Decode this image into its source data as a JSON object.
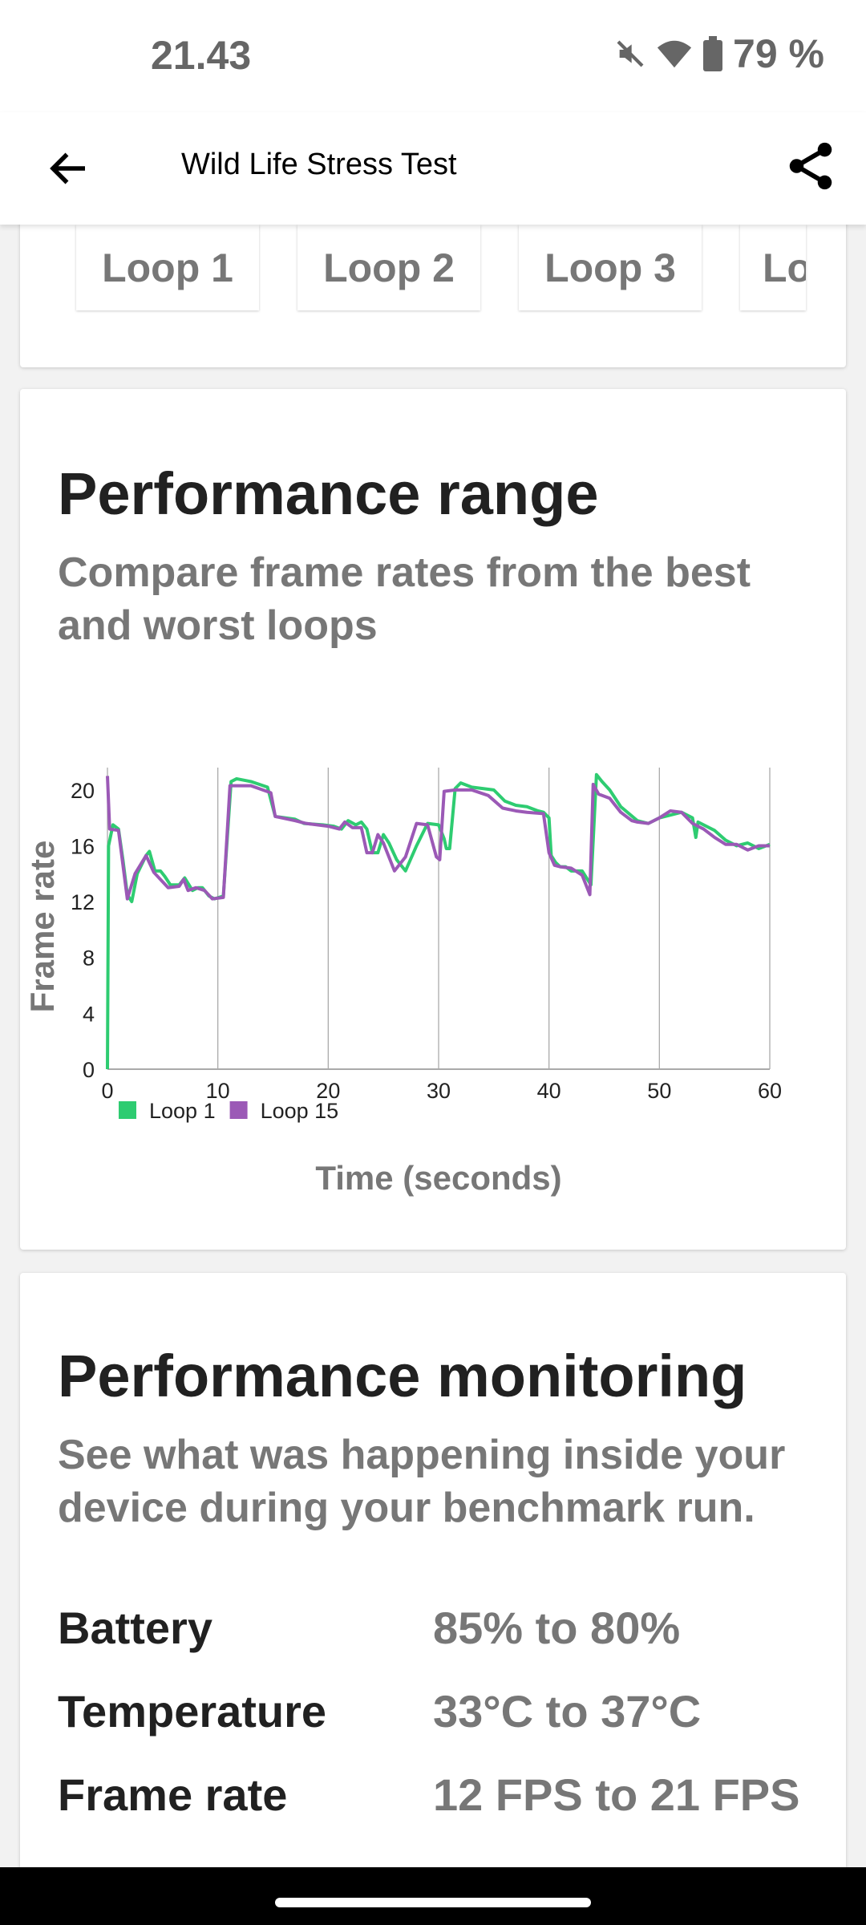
{
  "status_bar": {
    "time": "21.43",
    "battery": "79 %",
    "icons": [
      "mute-icon",
      "wifi-icon",
      "battery-icon"
    ]
  },
  "app_bar": {
    "title": "Wild Life Stress Test",
    "icons": [
      "back-arrow-icon",
      "share-icon"
    ]
  },
  "loops": [
    "Loop 1",
    "Loop 2",
    "Loop 3",
    "Lo"
  ],
  "performance_range": {
    "title": "Performance range",
    "subtitle": "Compare frame rates from the best and worst loops"
  },
  "chart_data": {
    "type": "line",
    "xlabel": "Time (seconds)",
    "ylabel": "Frame rate",
    "xlim": [
      0,
      60
    ],
    "ylim": [
      0,
      22
    ],
    "xticks": [
      0,
      10,
      20,
      30,
      40,
      50,
      60
    ],
    "yticks": [
      0,
      4,
      8,
      12,
      16,
      20
    ],
    "grid": "vertical",
    "legend": "bottom-left",
    "series": [
      {
        "name": "Loop 1",
        "color": "#2ecc71",
        "points": [
          [
            0,
            0
          ],
          [
            0.1,
            16
          ],
          [
            0.5,
            17.5
          ],
          [
            1,
            17.2
          ],
          [
            1.4,
            15
          ],
          [
            1.8,
            12.5
          ],
          [
            2.2,
            12
          ],
          [
            2.7,
            14
          ],
          [
            3.5,
            15.3
          ],
          [
            3.8,
            15.6
          ],
          [
            4.3,
            14.2
          ],
          [
            4.8,
            14.2
          ],
          [
            5.2,
            13.8
          ],
          [
            5.7,
            13.2
          ],
          [
            6.5,
            13.2
          ],
          [
            7,
            13.7
          ],
          [
            7.7,
            12.8
          ],
          [
            8.2,
            13
          ],
          [
            8.6,
            13
          ],
          [
            9.2,
            12.4
          ],
          [
            9.7,
            12.2
          ],
          [
            10.5,
            12.4
          ],
          [
            11.2,
            20.6
          ],
          [
            11.7,
            20.8
          ],
          [
            13,
            20.6
          ],
          [
            14.5,
            20.2
          ],
          [
            15.2,
            18.1
          ],
          [
            17,
            17.9
          ],
          [
            17.8,
            17.6
          ],
          [
            19.5,
            17.5
          ],
          [
            20.5,
            17.4
          ],
          [
            21.2,
            17.2
          ],
          [
            21.8,
            17.8
          ],
          [
            22.5,
            17.5
          ],
          [
            23,
            17.7
          ],
          [
            23.5,
            17.2
          ],
          [
            24,
            15.5
          ],
          [
            24.5,
            15.5
          ],
          [
            25,
            16.8
          ],
          [
            25.5,
            16.2
          ],
          [
            26.2,
            15
          ],
          [
            27,
            14.2
          ],
          [
            28,
            16
          ],
          [
            29,
            17.6
          ],
          [
            30,
            17.5
          ],
          [
            30.5,
            16.5
          ],
          [
            30.7,
            15.8
          ],
          [
            31,
            15.8
          ],
          [
            31.5,
            20.1
          ],
          [
            32,
            20.5
          ],
          [
            33,
            20.2
          ],
          [
            35,
            20
          ],
          [
            36,
            19.2
          ],
          [
            37,
            18.9
          ],
          [
            38,
            18.8
          ],
          [
            39,
            18.5
          ],
          [
            39.5,
            18.4
          ],
          [
            40,
            18
          ],
          [
            40.2,
            15.3
          ],
          [
            40.6,
            14.8
          ],
          [
            41,
            14.5
          ],
          [
            41.5,
            14.5
          ],
          [
            42,
            14.2
          ],
          [
            43,
            14.2
          ],
          [
            43.8,
            13.2
          ],
          [
            44.3,
            21.1
          ],
          [
            44.8,
            20.6
          ],
          [
            45.5,
            20
          ],
          [
            46.5,
            18.8
          ],
          [
            48,
            17.8
          ],
          [
            49,
            17.6
          ],
          [
            50,
            18
          ],
          [
            51,
            18.2
          ],
          [
            52,
            18.4
          ],
          [
            53,
            18
          ],
          [
            53.3,
            16.6
          ],
          [
            53.5,
            17.7
          ],
          [
            55,
            17.1
          ],
          [
            56,
            16.4
          ],
          [
            57,
            16
          ],
          [
            58,
            16.2
          ],
          [
            59,
            15.8
          ],
          [
            60,
            16.1
          ]
        ]
      },
      {
        "name": "Loop 15",
        "color": "#9b59b6",
        "points": [
          [
            0,
            21
          ],
          [
            0.2,
            17.2
          ],
          [
            1,
            17.1
          ],
          [
            1.8,
            12.2
          ],
          [
            2.5,
            14
          ],
          [
            3.5,
            15.3
          ],
          [
            4.2,
            14.1
          ],
          [
            5.5,
            13
          ],
          [
            6.5,
            13.1
          ],
          [
            6.9,
            13.6
          ],
          [
            7.3,
            12.8
          ],
          [
            8,
            13
          ],
          [
            8.8,
            12.8
          ],
          [
            9.5,
            12.2
          ],
          [
            10.5,
            12.3
          ],
          [
            11.1,
            20.3
          ],
          [
            13,
            20.3
          ],
          [
            14.8,
            19.8
          ],
          [
            15.2,
            18.1
          ],
          [
            17,
            17.8
          ],
          [
            18,
            17.6
          ],
          [
            20,
            17.4
          ],
          [
            21,
            17.2
          ],
          [
            21.5,
            17.7
          ],
          [
            22.2,
            17.3
          ],
          [
            23,
            17.3
          ],
          [
            23.5,
            15.5
          ],
          [
            24,
            15.5
          ],
          [
            24.5,
            16.8
          ],
          [
            25,
            16.2
          ],
          [
            26,
            14.2
          ],
          [
            27,
            15.2
          ],
          [
            28,
            17.6
          ],
          [
            29,
            17.5
          ],
          [
            29.8,
            15.2
          ],
          [
            30.1,
            15
          ],
          [
            30.5,
            19.9
          ],
          [
            31.5,
            20
          ],
          [
            33,
            20
          ],
          [
            34.5,
            19.6
          ],
          [
            35.8,
            18.7
          ],
          [
            37,
            18.5
          ],
          [
            38,
            18.4
          ],
          [
            39.5,
            18.3
          ],
          [
            40,
            15.5
          ],
          [
            40.5,
            14.6
          ],
          [
            41,
            14.5
          ],
          [
            42,
            14.4
          ],
          [
            43,
            13.9
          ],
          [
            43.7,
            12.5
          ],
          [
            44,
            20.4
          ],
          [
            44.5,
            19.7
          ],
          [
            45.5,
            19.4
          ],
          [
            46.5,
            18.4
          ],
          [
            47.5,
            17.8
          ],
          [
            48,
            17.7
          ],
          [
            49,
            17.6
          ],
          [
            50,
            18
          ],
          [
            51,
            18.5
          ],
          [
            52,
            18.4
          ],
          [
            53,
            17.6
          ],
          [
            54,
            17.2
          ],
          [
            55,
            16.6
          ],
          [
            56,
            16.1
          ],
          [
            57,
            16.1
          ],
          [
            58,
            15.7
          ],
          [
            59,
            16
          ],
          [
            60,
            16
          ]
        ]
      }
    ]
  },
  "performance_monitoring": {
    "title": "Performance monitoring",
    "subtitle": "See what was happening inside your device during your benchmark run.",
    "rows": [
      {
        "label": "Battery",
        "value": "85% to 80%"
      },
      {
        "label": "Temperature",
        "value": "33°C to 37°C"
      },
      {
        "label": "Frame rate",
        "value": "12 FPS to 21 FPS"
      }
    ]
  }
}
